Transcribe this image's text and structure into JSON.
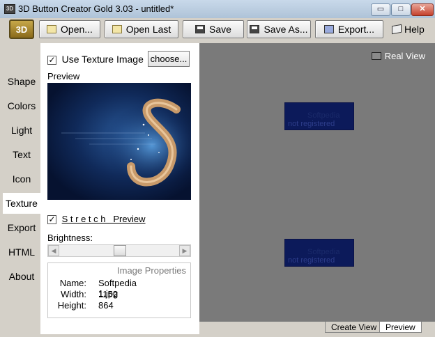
{
  "window": {
    "title": "3D Button Creator Gold 3.03 - untitled*",
    "controls": {
      "minimize": "▭",
      "maximize": "□",
      "close": "✕"
    }
  },
  "toolbar": {
    "logo": "3D",
    "open": "Open...",
    "open_last": "Open Last",
    "save": "Save",
    "save_as": "Save As...",
    "export": "Export...",
    "help": "Help"
  },
  "sidebar": {
    "items": [
      "Shape",
      "Colors",
      "Light",
      "Text",
      "Icon",
      "Texture",
      "Export",
      "HTML",
      "About"
    ],
    "active": "Texture"
  },
  "texture_panel": {
    "use_texture_label": "Use Texture Image",
    "use_texture_checked": true,
    "choose_label": "choose...",
    "preview_label": "Preview",
    "stretch_label": "S t r e t c h   Preview",
    "stretch_checked": true,
    "brightness_label": "Brightness:",
    "brightness_value": 0.5,
    "image_properties": {
      "title": "Image Properties",
      "rows": [
        {
          "key": "Name:",
          "value": "Softpedia 1.jpg"
        },
        {
          "key": "Width:",
          "value": "1152"
        },
        {
          "key": "Height:",
          "value": "864"
        }
      ]
    }
  },
  "canvas": {
    "real_view_label": "Real View",
    "buttons": [
      {
        "text": "Softpedia",
        "watermark": "not registered"
      },
      {
        "text": "Softpedia",
        "watermark": "not registered"
      }
    ]
  },
  "bottom_tabs": [
    "Create View",
    "Preview"
  ],
  "colors": {
    "canvas_bg": "#7a7a7a",
    "button_fill": "#0c1a5a",
    "panel_bg": "#ffffff"
  }
}
